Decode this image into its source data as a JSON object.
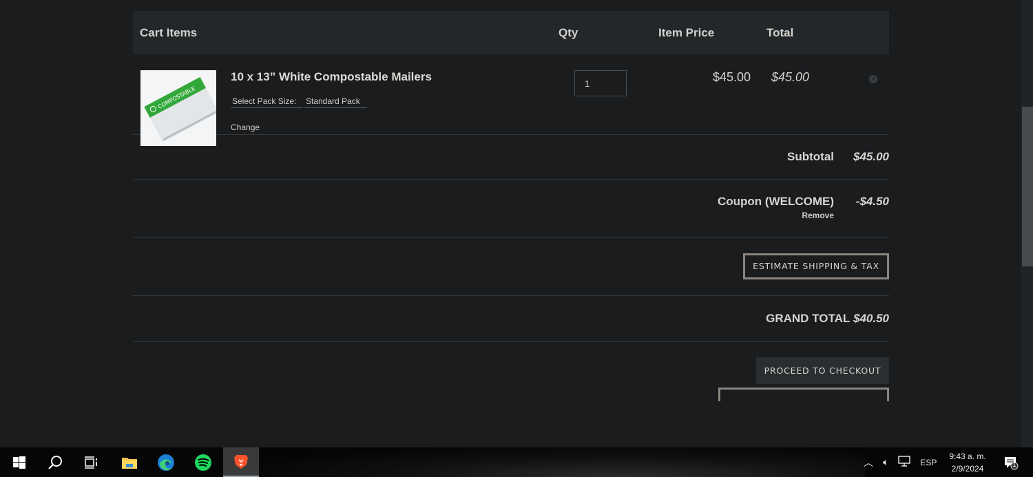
{
  "cart": {
    "headers": {
      "items": "Cart Items",
      "qty": "Qty",
      "item_price": "Item Price",
      "total": "Total"
    },
    "items": [
      {
        "title": "10 x 13” White Compostable Mailers",
        "image_label": "COMPOSTABLE",
        "option_label": "Select Pack Size:",
        "option_value": "Standard Pack",
        "change_label": "Change",
        "qty": "1",
        "price": "$45.00",
        "line_total": "$45.00",
        "remove_icon": "close-circle-icon"
      }
    ]
  },
  "summary": {
    "subtotal_label": "Subtotal",
    "subtotal_value": "$45.00",
    "coupon_label": "Coupon (WELCOME)",
    "coupon_value": "-$4.50",
    "coupon_remove": "Remove",
    "estimate_button": "ESTIMATE SHIPPING & TAX",
    "grand_total_label": "GRAND TOTAL",
    "grand_total_value": "$40.50",
    "checkout_button": "PROCEED TO CHECKOUT"
  },
  "taskbar": {
    "apps": [
      "start-icon",
      "search-icon",
      "task-view-icon",
      "file-explorer-icon",
      "edge-icon",
      "spotify-icon",
      "brave-icon"
    ],
    "active_app": "brave-icon",
    "language": "ESP",
    "time": "9:43 a. m.",
    "date": "2/9/2024",
    "notification_count": "1"
  },
  "colors": {
    "page_bg": "#1a1c1e",
    "header_bg": "#232729",
    "text": "#d6d4cf",
    "accent_border": "#8a8580"
  }
}
